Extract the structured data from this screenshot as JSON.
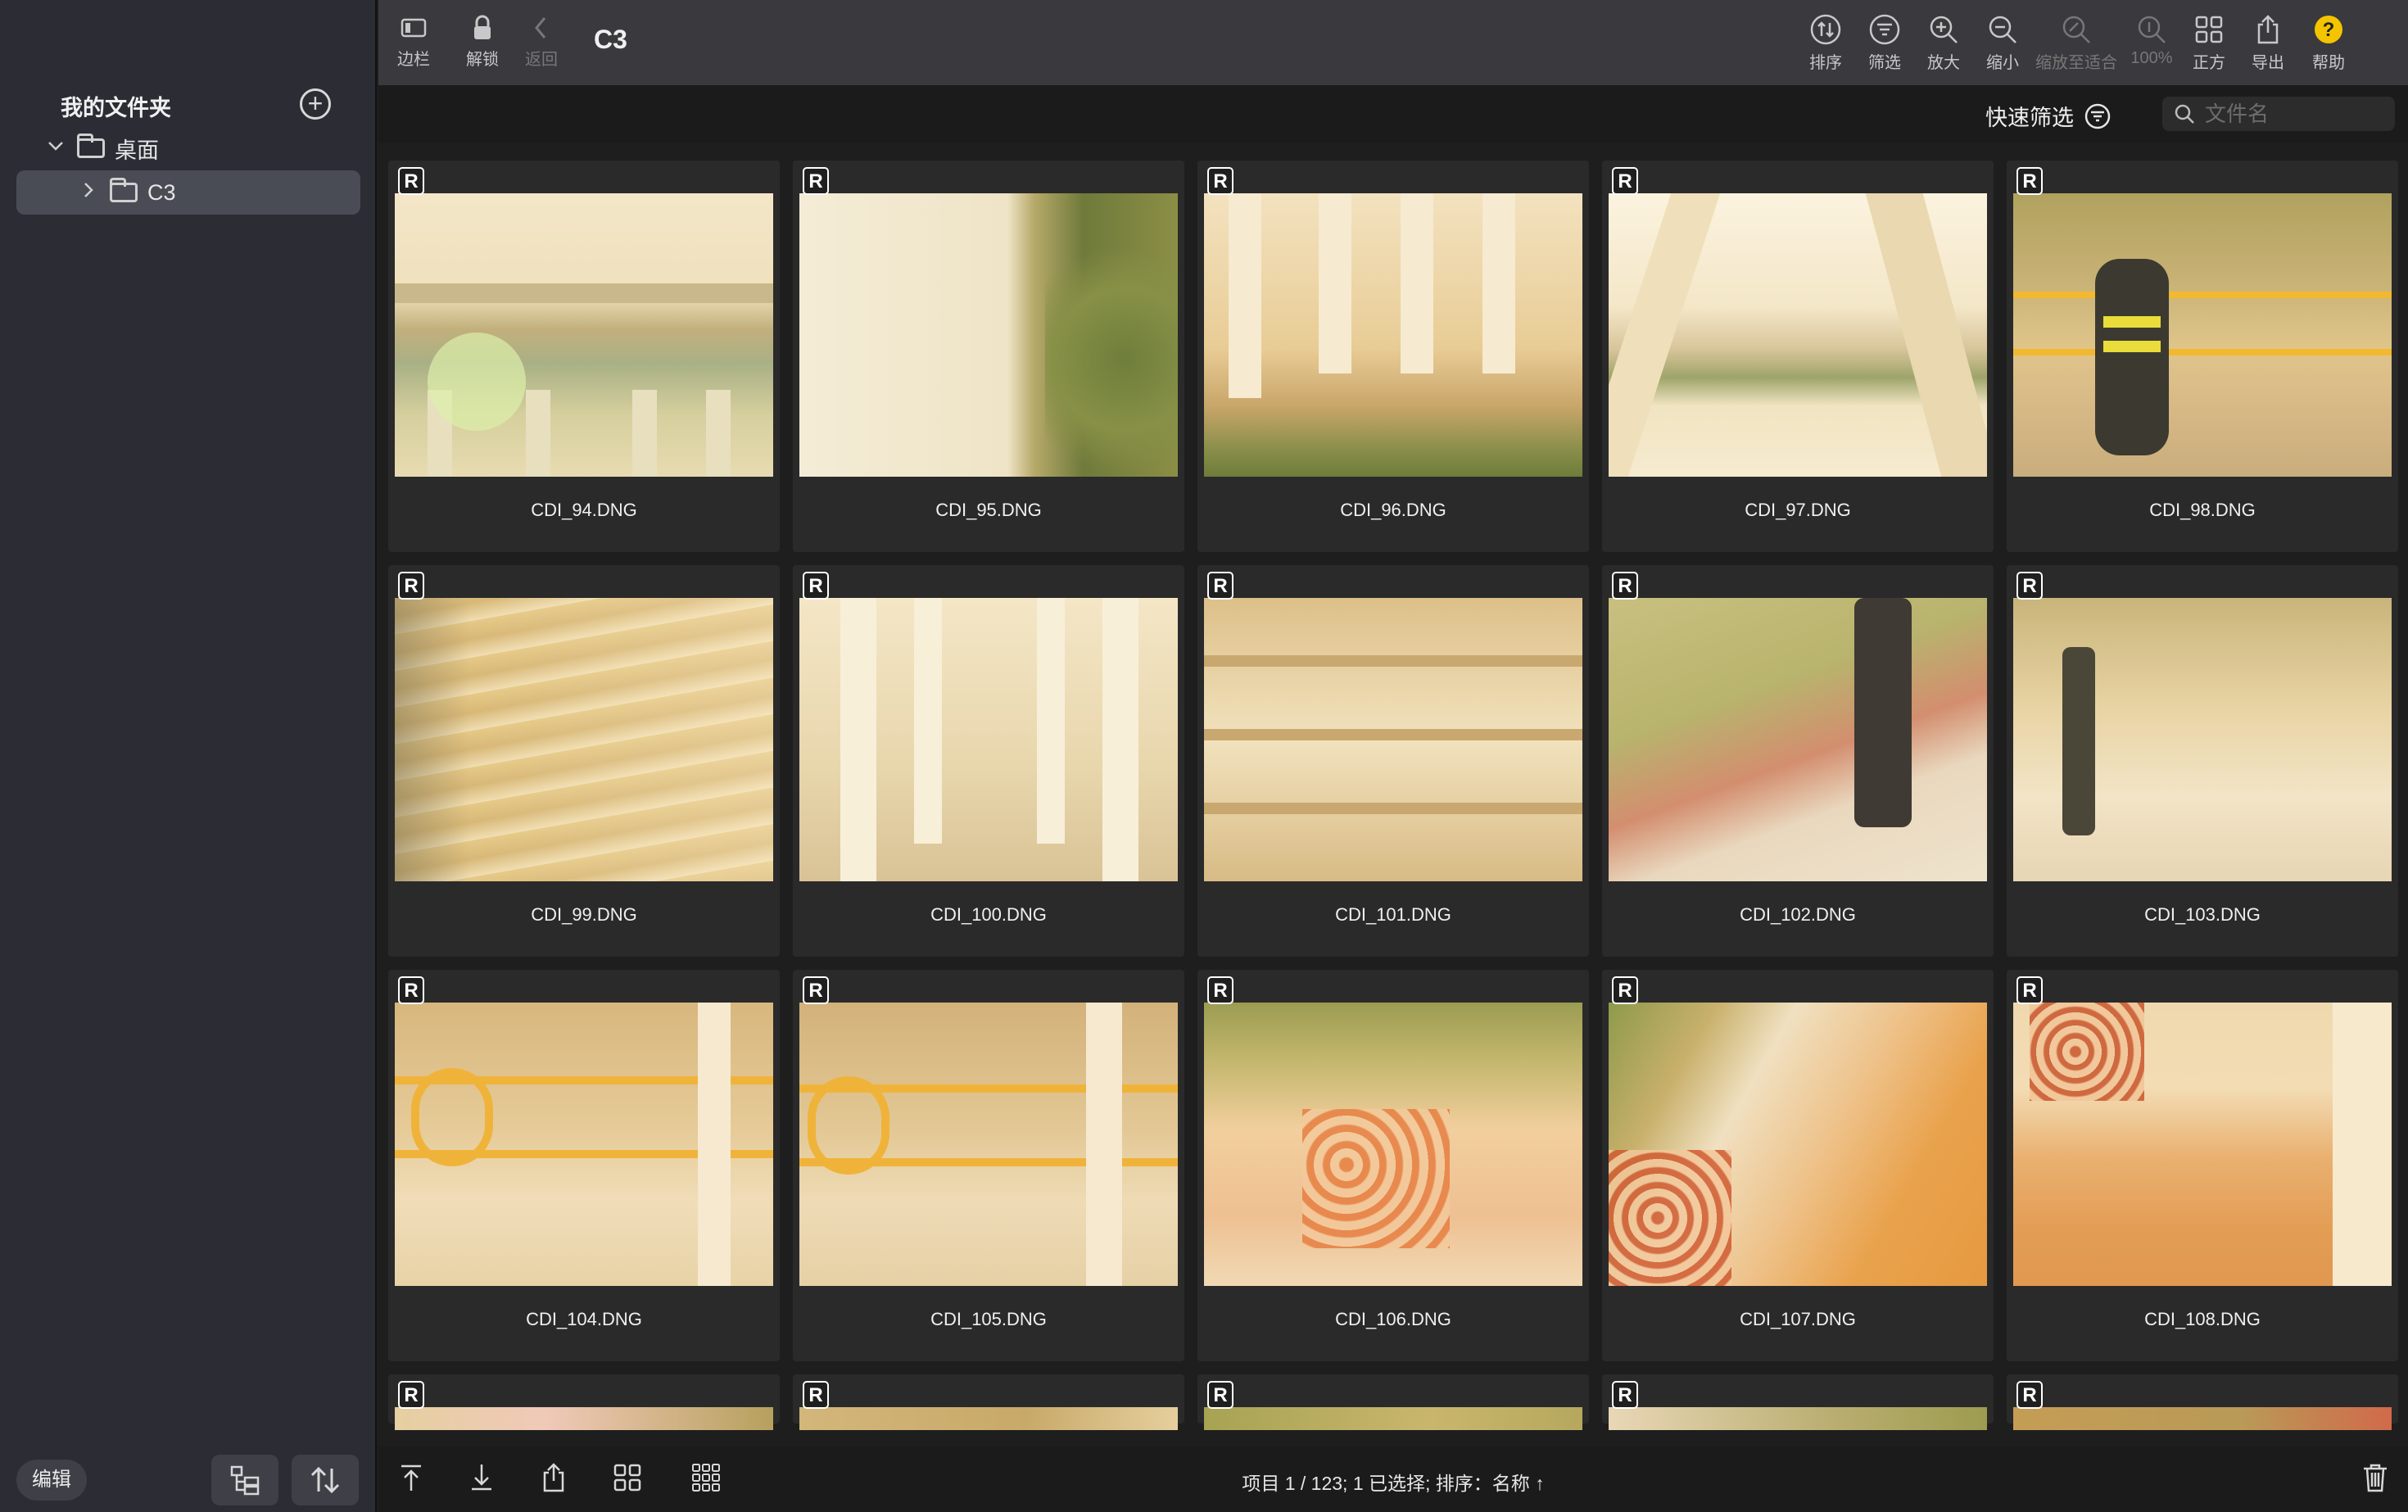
{
  "sidebar": {
    "header": "我的文件夹",
    "tree": [
      {
        "label": "桌面"
      },
      {
        "label": "C3"
      }
    ],
    "edit_label": "编辑"
  },
  "toolbar": {
    "title": "C3",
    "left": [
      {
        "label": "边栏",
        "icon": "sidebar-icon"
      },
      {
        "label": "解锁",
        "icon": "lock-icon"
      },
      {
        "label": "返回",
        "icon": "chevron-left-icon"
      }
    ],
    "right": [
      {
        "label": "排序",
        "icon": "sort-icon"
      },
      {
        "label": "筛选",
        "icon": "filter-icon"
      },
      {
        "label": "放大",
        "icon": "zoom-in-icon"
      },
      {
        "label": "缩小",
        "icon": "zoom-out-icon"
      },
      {
        "label": "缩放至适合",
        "icon": "zoom-fit-icon"
      },
      {
        "label": "100%",
        "icon": "actual-size-icon"
      },
      {
        "label": "正方",
        "icon": "square-grid-icon"
      },
      {
        "label": "导出",
        "icon": "export-icon"
      },
      {
        "label": "帮助",
        "icon": "help-icon"
      }
    ]
  },
  "filter": {
    "quick_filter_label": "快速筛选",
    "search_placeholder": "文件名"
  },
  "raw_badge": "R",
  "files": [
    "CDI_94.DNG",
    "CDI_95.DNG",
    "CDI_96.DNG",
    "CDI_97.DNG",
    "CDI_98.DNG",
    "CDI_99.DNG",
    "CDI_100.DNG",
    "CDI_101.DNG",
    "CDI_102.DNG",
    "CDI_103.DNG",
    "CDI_104.DNG",
    "CDI_105.DNG",
    "CDI_106.DNG",
    "CDI_107.DNG",
    "CDI_108.DNG"
  ],
  "status_text": "项目 1 / 123; 1 已选择; 排序：名称 ↑",
  "colors": {
    "sidebar_bg": "#2b2c34",
    "toolbar_bg": "#3a3a3e",
    "selected_row": "#4a4c55",
    "help_yellow": "#f5c400"
  }
}
